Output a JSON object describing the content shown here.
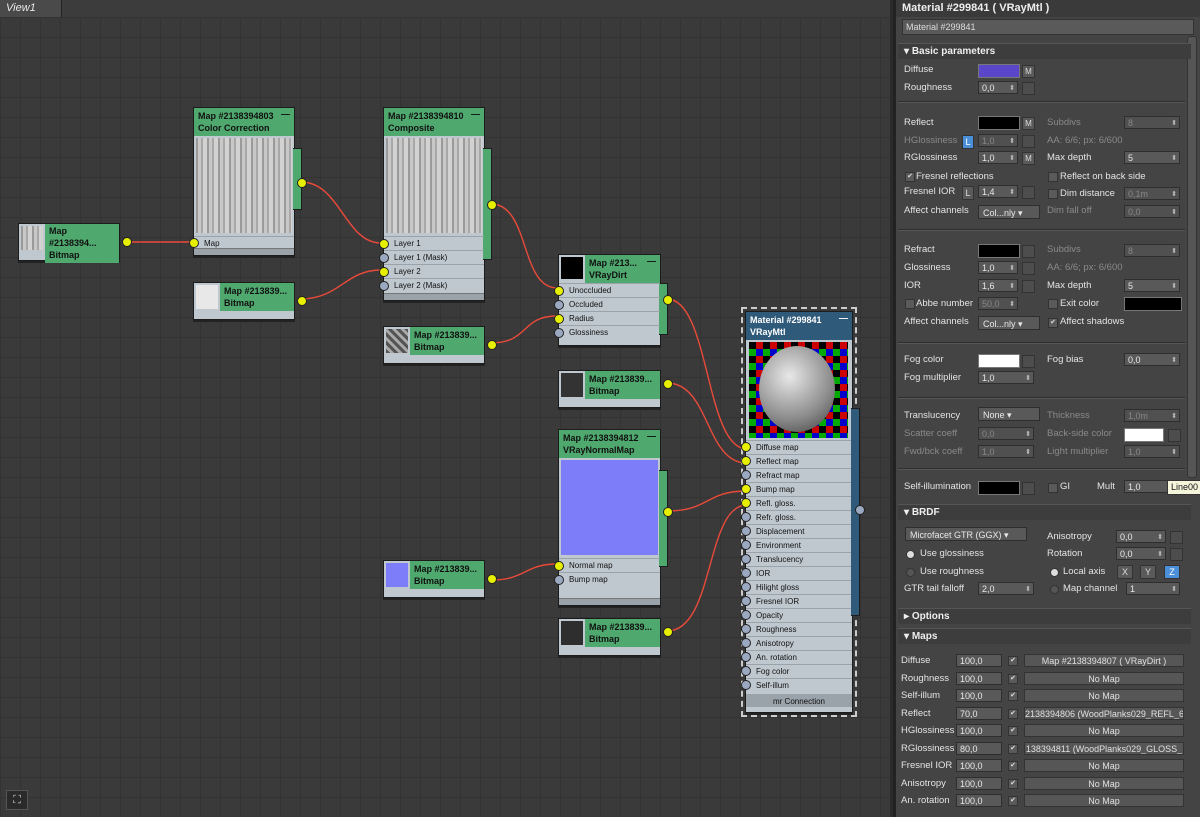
{
  "view": {
    "tab": "View1"
  },
  "nodes": {
    "bitmap_a": {
      "title": "Map #2138394...",
      "type": "Bitmap"
    },
    "color_corr": {
      "title": "Map #2138394803",
      "type": "Color Correction",
      "slot": "Map"
    },
    "bitmap_b": {
      "title": "Map #213839...",
      "type": "Bitmap"
    },
    "composite": {
      "title": "Map #2138394810",
      "type": "Composite",
      "slots": [
        "Layer 1",
        "Layer 1 (Mask)",
        "Layer 2",
        "Layer 2 (Mask)"
      ]
    },
    "bitmap_c": {
      "title": "Map #213839...",
      "type": "Bitmap"
    },
    "vraydirt": {
      "title": "Map #213...",
      "type": "VRayDirt",
      "slots": [
        "Unoccluded",
        "Occluded",
        "Radius",
        "Glossiness"
      ]
    },
    "bitmap_d": {
      "title": "Map #213839...",
      "type": "Bitmap"
    },
    "normalmap": {
      "title": "Map #2138394812",
      "type": "VRayNormalMap",
      "slots": [
        "Normal map",
        "Bump map"
      ]
    },
    "bitmap_e": {
      "title": "Map #213839...",
      "type": "Bitmap"
    },
    "bitmap_f": {
      "title": "Map #213839...",
      "type": "Bitmap"
    },
    "vraymtl": {
      "title": "Material #299841",
      "type": "VRayMtl",
      "slots": [
        "Diffuse map",
        "Reflect map",
        "Refract map",
        "Bump map",
        "Refl. gloss.",
        "Refr. gloss.",
        "Displacement",
        "Environment",
        "Translucency",
        "IOR",
        "Hilight gloss",
        "Fresnel IOR",
        "Opacity",
        "Roughness",
        "Anisotropy",
        "An. rotation",
        "Fog color",
        "Self-illum"
      ],
      "footer": "mr Connection"
    }
  },
  "panel": {
    "title": "Material #299841  ( VRayMtl )",
    "name_value": "Material #299841",
    "basic": {
      "header": "Basic parameters",
      "diffuse": "Diffuse",
      "roughness": "Roughness",
      "roughness_val": "0,0",
      "reflect": "Reflect",
      "subdivs": "Subdivs",
      "subdivs_val": "8",
      "hglossiness": "HGlossiness",
      "hgloss_val": "1,0",
      "aa": "AA: 6/6; px: 6/600",
      "rglossiness": "RGlossiness",
      "rgloss_val": "1,0",
      "max_depth": "Max depth",
      "max_depth_val": "5",
      "fresnel_refl": "Fresnel reflections",
      "reflect_back": "Reflect on back side",
      "fresnel_ior": "Fresnel IOR",
      "fresnel_ior_val": "1,4",
      "dim_dist": "Dim distance",
      "dim_dist_val": "0,1m",
      "affect_channels": "Affect channels",
      "affect_val": "Col...nly",
      "dim_falloff": "Dim fall off",
      "dim_falloff_val": "0,0",
      "refract": "Refract",
      "r_subdivs_val": "8",
      "r_aa": "AA: 6/6; px: 6/600",
      "glossiness": "Glossiness",
      "gloss_val": "1,0",
      "ior": "IOR",
      "ior_val": "1,6",
      "r_max_depth_val": "5",
      "abbe": "Abbe number",
      "abbe_val": "50,0",
      "exit_color": "Exit color",
      "affect_shadows": "Affect shadows",
      "fog_color": "Fog color",
      "fog_bias": "Fog bias",
      "fog_bias_val": "0,0",
      "fog_mult": "Fog multiplier",
      "fog_mult_val": "1,0",
      "translucency": "Translucency",
      "transl_val": "None",
      "thickness": "Thickness",
      "thickness_val": "1,0m",
      "scatter": "Scatter coeff",
      "scatter_val": "0,0",
      "backside": "Back-side color",
      "fwdbck": "Fwd/bck coeff",
      "fwdbck_val": "1,0",
      "light_mult": "Light multiplier",
      "light_mult_val": "1,0",
      "self_illum": "Self-illumination",
      "gi": "GI",
      "mult": "Mult",
      "mult_val": "1,0",
      "tooltip": "Line00"
    },
    "brdf": {
      "header": "BRDF",
      "model": "Microfacet GTR (GGX)",
      "anisotropy": "Anisotropy",
      "aniso_val": "0,0",
      "use_gloss": "Use glossiness",
      "rotation": "Rotation",
      "rot_val": "0,0",
      "use_rough": "Use roughness",
      "local_axis": "Local axis",
      "x": "X",
      "y": "Y",
      "z": "Z",
      "gtr": "GTR tail falloff",
      "gtr_val": "2,0",
      "map_channel": "Map channel",
      "map_channel_val": "1"
    },
    "options": {
      "header": "Options"
    },
    "maps": {
      "header": "Maps",
      "rows": [
        {
          "name": "Diffuse",
          "amount": "100,0",
          "map": "Map #2138394807  ( VRayDirt )"
        },
        {
          "name": "Roughness",
          "amount": "100,0",
          "map": "No Map"
        },
        {
          "name": "Self-illum",
          "amount": "100,0",
          "map": "No Map"
        },
        {
          "name": "Reflect",
          "amount": "70,0",
          "map": "2138394806 (WoodPlanks029_REFL_6"
        },
        {
          "name": "HGlossiness",
          "amount": "100,0",
          "map": "No Map"
        },
        {
          "name": "RGlossiness",
          "amount": "80,0",
          "map": "138394811 (WoodPlanks029_GLOSS_"
        },
        {
          "name": "Fresnel IOR",
          "amount": "100,0",
          "map": "No Map"
        },
        {
          "name": "Anisotropy",
          "amount": "100,0",
          "map": "No Map"
        },
        {
          "name": "An. rotation",
          "amount": "100,0",
          "map": "No Map"
        }
      ]
    },
    "colors": {
      "diffuse": "#5a46c8",
      "reflect": "#000000",
      "refract": "#000000",
      "fog": "#ffffff",
      "exit": "#000000",
      "backside": "#ffffff",
      "selfillum": "#000000"
    }
  }
}
